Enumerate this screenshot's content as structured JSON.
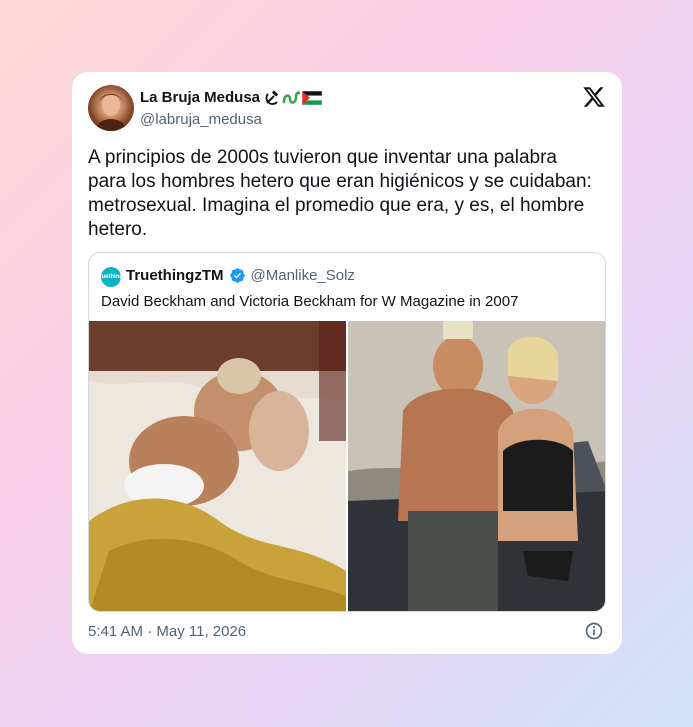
{
  "tweet": {
    "author_name": "La Bruja Medusa",
    "author_handle": "@labruja_medusa",
    "text": "A principios de 2000s tuvieron que inventar una palabra para los hombres hetero que eran higiénicos y se cuidaban: metrosexual. Imagina el promedio que era, y es, el hombre hetero.",
    "timestamp": "5:41 AM · May 11, 2026",
    "name_icons": [
      "hammer-sickle-icon",
      "snake-icon",
      "palestine-flag-icon"
    ]
  },
  "quoted": {
    "author_name": "TruethingzTM",
    "author_handle": "@Manlike_Solz",
    "avatar_text": "Truethingz",
    "text": "David Beckham and Victoria Beckham for W Magazine in 2007"
  },
  "colors": {
    "text": "#0f1419",
    "muted": "#536471",
    "verified": "#1d9bf0",
    "border": "#cfd9de"
  }
}
